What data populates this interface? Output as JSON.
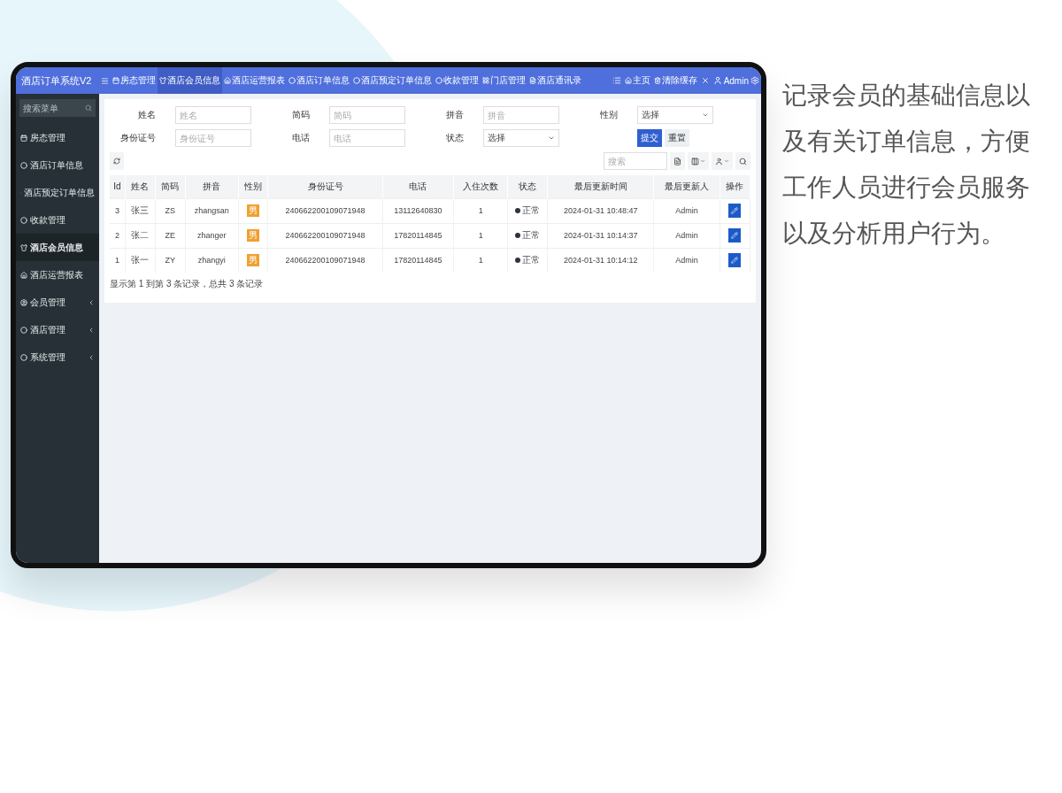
{
  "brand": "酒店订单系统V2",
  "nav_tabs": [
    {
      "label": "房态管理",
      "selected": false
    },
    {
      "label": "酒店会员信息",
      "selected": true
    },
    {
      "label": "酒店运营报表",
      "selected": false
    },
    {
      "label": "酒店订单信息",
      "selected": false
    },
    {
      "label": "酒店预定订单信息",
      "selected": false
    },
    {
      "label": "收款管理",
      "selected": false
    },
    {
      "label": "门店管理",
      "selected": false
    },
    {
      "label": "酒店通讯录",
      "selected": false
    }
  ],
  "header_links": [
    "主页",
    "清除缓存"
  ],
  "user": "Admin",
  "sidebar": {
    "search_placeholder": "搜索菜单",
    "items": [
      {
        "label": "房态管理",
        "selected": false,
        "has_children": false
      },
      {
        "label": "酒店订单信息",
        "selected": false,
        "has_children": false
      },
      {
        "label": "酒店预定订单信息",
        "selected": false,
        "has_children": false
      },
      {
        "label": "收款管理",
        "selected": false,
        "has_children": false
      },
      {
        "label": "酒店会员信息",
        "selected": true,
        "has_children": false
      },
      {
        "label": "酒店运营报表",
        "selected": false,
        "has_children": false
      },
      {
        "label": "会员管理",
        "selected": false,
        "has_children": true
      },
      {
        "label": "酒店管理",
        "selected": false,
        "has_children": true
      },
      {
        "label": "系统管理",
        "selected": false,
        "has_children": true
      }
    ]
  },
  "filters": [
    {
      "label": "姓名",
      "kind": "input",
      "placeholder": "姓名"
    },
    {
      "label": "简码",
      "kind": "input",
      "placeholder": "简码"
    },
    {
      "label": "拼音",
      "kind": "input",
      "placeholder": "拼音"
    },
    {
      "label": "性别",
      "kind": "select",
      "value": "选择"
    },
    {
      "label": "身份证号",
      "kind": "input",
      "placeholder": "身份证号"
    },
    {
      "label": "电话",
      "kind": "input",
      "placeholder": "电话"
    },
    {
      "label": "状态",
      "kind": "select",
      "value": "选择"
    }
  ],
  "filter_buttons": [
    {
      "label": "提交",
      "kind": "primary"
    },
    {
      "label": "重置",
      "kind": "default"
    }
  ],
  "table_search_placeholder": "搜索",
  "table": {
    "columns": [
      "Id",
      "姓名",
      "简码",
      "拼音",
      "性别",
      "身份证号",
      "电话",
      "入住次数",
      "状态",
      "最后更新时间",
      "最后更新人",
      "操作"
    ],
    "rows": [
      {
        "id": "3",
        "name": "张三",
        "code": "ZS",
        "pinyin": "zhangsan",
        "gender": "男",
        "id_number": "240662200109071948",
        "phone": "13112640830",
        "stays": "1",
        "status": "正常",
        "updated_at": "2024-01-31 10:48:47",
        "updated_by": "Admin"
      },
      {
        "id": "2",
        "name": "张二",
        "code": "ZE",
        "pinyin": "zhanger",
        "gender": "男",
        "id_number": "240662200109071948",
        "phone": "17820114845",
        "stays": "1",
        "status": "正常",
        "updated_at": "2024-01-31 10:14:37",
        "updated_by": "Admin"
      },
      {
        "id": "1",
        "name": "张一",
        "code": "ZY",
        "pinyin": "zhangyi",
        "gender": "男",
        "id_number": "240662200109071948",
        "phone": "17820114845",
        "stays": "1",
        "status": "正常",
        "updated_at": "2024-01-31 10:14:12",
        "updated_by": "Admin"
      }
    ]
  },
  "pagination": "显示第 1 到第 3 条记录，总共 3 条记录",
  "description": "记录会员的基础信息以及有关订单信息，方便工作人员进行会员服务以及分析用户行为。"
}
